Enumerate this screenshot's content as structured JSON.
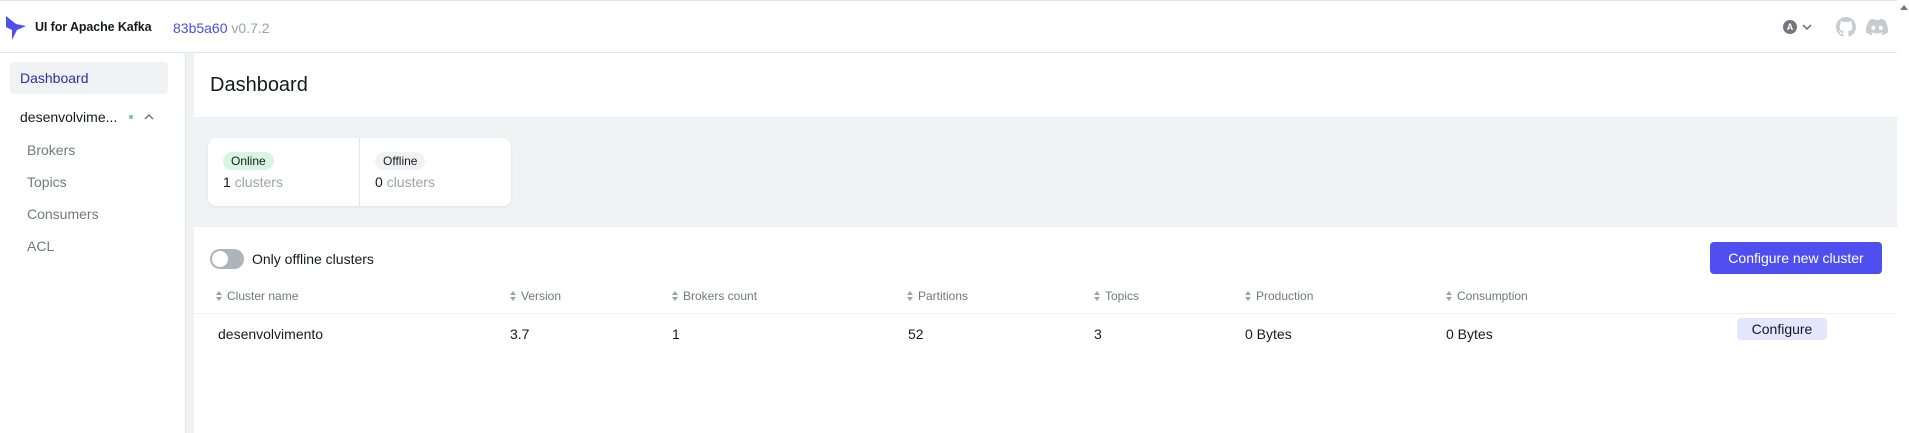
{
  "header": {
    "app_title": "UI for Apache Kafka",
    "commit_hash": "83b5a60",
    "version": "v0.7.2",
    "user_initial": "A",
    "brand_color": "#4f4ff0"
  },
  "sidebar": {
    "dashboard_label": "Dashboard",
    "cluster_name": "desenvolvime...",
    "cluster_status_color": "#5bd68b",
    "items": [
      {
        "label": "Brokers"
      },
      {
        "label": "Topics"
      },
      {
        "label": "Consumers"
      },
      {
        "label": "ACL"
      }
    ]
  },
  "main": {
    "title": "Dashboard",
    "metrics": {
      "online_label": "Online",
      "online_count": "1",
      "online_unit": "clusters",
      "offline_label": "Offline",
      "offline_count": "0",
      "offline_unit": "clusters"
    },
    "filter": {
      "toggle_label": "Only offline clusters",
      "toggle_on": false
    },
    "configure_new_label": "Configure new cluster",
    "table": {
      "columns": [
        "Cluster name",
        "Version",
        "Brokers count",
        "Partitions",
        "Topics",
        "Production",
        "Consumption"
      ],
      "rows": [
        {
          "cluster_name": "desenvolvimento",
          "version": "3.7",
          "brokers_count": "1",
          "partitions": "52",
          "topics": "3",
          "production": "0 Bytes",
          "consumption": "0 Bytes",
          "action_label": "Configure"
        }
      ]
    }
  }
}
